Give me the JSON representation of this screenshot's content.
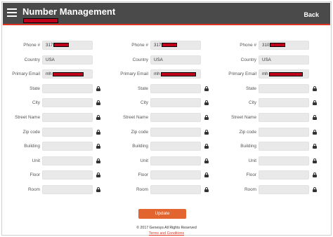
{
  "header": {
    "title": "Number Management",
    "back_label": "Back",
    "menu_icon": "hamburger-menu-icon",
    "colors": {
      "bar": "#4a4a4a",
      "accent": "#e03424"
    }
  },
  "labels": {
    "phone": "Phone #",
    "country": "Country",
    "email": "Primary Email",
    "state": "State",
    "city": "City",
    "street": "Street Name",
    "zip": "Zip code",
    "building": "Building",
    "unit": "Unit",
    "floor": "Floor",
    "room": "Room"
  },
  "columns": [
    {
      "phone_prefix": "317",
      "country": "USA",
      "email_prefix": "mh",
      "state": "",
      "city": "",
      "street": "",
      "zip": "",
      "building": "",
      "unit": "",
      "floor": "",
      "room": ""
    },
    {
      "phone_prefix": "317",
      "country": "USA",
      "email_prefix": "mh",
      "state": "",
      "city": "",
      "street": "",
      "zip": "",
      "building": "",
      "unit": "",
      "floor": "",
      "room": ""
    },
    {
      "phone_prefix": "310",
      "country": "USA",
      "email_prefix": "mh",
      "state": "",
      "city": "",
      "street": "",
      "zip": "",
      "building": "",
      "unit": "",
      "floor": "",
      "room": ""
    }
  ],
  "actions": {
    "update_label": "Update",
    "update_color": "#e2642e"
  },
  "footer": {
    "copyright": "© 2017 Genesys All Rights Reserved",
    "terms": "Terms and Conditions"
  }
}
